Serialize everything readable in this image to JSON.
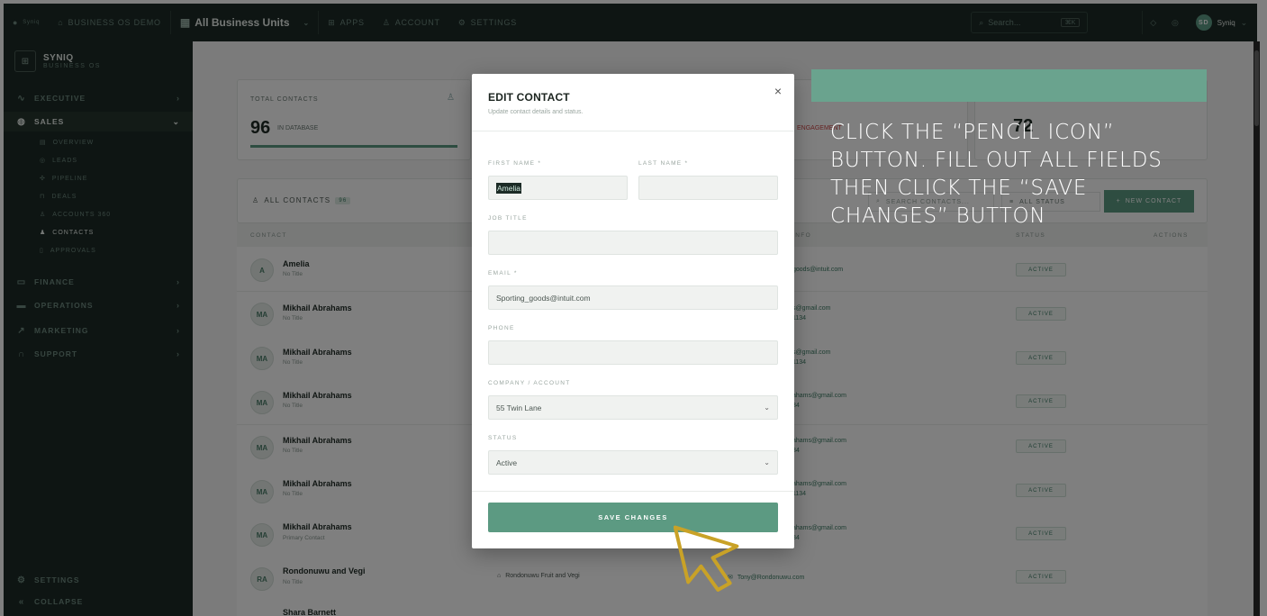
{
  "topbar": {
    "brand_small": "Syniq",
    "demo": "BUSINESS OS DEMO",
    "units": "All Business Units",
    "nav": [
      "APPS",
      "ACCOUNT",
      "SETTINGS"
    ],
    "search_placeholder": "Search...",
    "search_kbd": "⌘K",
    "user_initials": "SD",
    "user_name": "Syniq"
  },
  "sidebar": {
    "brand_name": "SYNIQ",
    "brand_sub": "BUSINESS OS",
    "sections": [
      {
        "label": "EXECUTIVE",
        "icon": "pulse-icon"
      },
      {
        "label": "SALES",
        "icon": "globe-icon"
      },
      {
        "label": "FINANCE",
        "icon": "card-icon"
      },
      {
        "label": "OPERATIONS",
        "icon": "folder-icon"
      },
      {
        "label": "MARKETING",
        "icon": "trend-icon"
      },
      {
        "label": "SUPPORT",
        "icon": "headset-icon"
      }
    ],
    "sales_items": [
      "OVERVIEW",
      "LEADS",
      "PIPELINE",
      "DEALS",
      "ACCOUNTS 360",
      "CONTACTS",
      "APPROVALS"
    ],
    "settings": "SETTINGS",
    "collapse": "COLLAPSE"
  },
  "stats": {
    "total_label": "TOTAL CONTACTS",
    "total_value": "96",
    "total_sub": "IN DATABASE",
    "engagement_label": "ENGAGEMENT",
    "active_value": "72"
  },
  "contacts": {
    "header": "ALL CONTACTS",
    "count": "96",
    "search_placeholder": "SEARCH CONTACTS...",
    "status_filter": "ALL STATUS",
    "new_button": "NEW CONTACT",
    "columns": [
      "CONTACT",
      "INFO",
      "STATUS",
      "ACTIONS"
    ],
    "rows": [
      {
        "initials": "A",
        "name": "Amelia",
        "sub": "No Title",
        "email": "goods@intuit.com",
        "phone": "",
        "status": "ACTIVE"
      },
      {
        "initials": "MA",
        "name": "Mikhail Abrahams",
        "sub": "No Title",
        "email": "s@gmail.com",
        "phone": "1134",
        "status": "ACTIVE"
      },
      {
        "initials": "MA",
        "name": "Mikhail Abrahams",
        "sub": "No Title",
        "email": "s@gmail.com",
        "phone": "1134",
        "status": "ACTIVE"
      },
      {
        "initials": "MA",
        "name": "Mikhail Abrahams",
        "sub": "No Title",
        "email": "ahams@gmail.com",
        "phone": "34",
        "status": "ACTIVE"
      },
      {
        "initials": "MA",
        "name": "Mikhail Abrahams",
        "sub": "No Title",
        "email": "ahams@gmail.com",
        "phone": "34",
        "status": "ACTIVE"
      },
      {
        "initials": "MA",
        "name": "Mikhail Abrahams",
        "sub": "No Title",
        "email": "ahams@gmail.com",
        "phone": "1134",
        "status": "ACTIVE"
      },
      {
        "initials": "MA",
        "name": "Mikhail Abrahams",
        "sub": "Primary Contact",
        "email": "ahams@gmail.com",
        "phone": "34",
        "status": "ACTIVE"
      },
      {
        "initials": "RA",
        "name": "Rondonuwu and Vegi",
        "sub": "No Title",
        "email": "Tony@Rondonuwu.com",
        "phone": "",
        "status": "ACTIVE",
        "company": "Rondonuwu Fruit and Vegi"
      },
      {
        "initials": "",
        "name": "Shara Barnett",
        "sub": "",
        "email": "",
        "phone": "",
        "status": ""
      }
    ]
  },
  "modal": {
    "title": "EDIT CONTACT",
    "subtitle": "Update contact details and status.",
    "close": "×",
    "first_name_label": "FIRST NAME *",
    "first_name_value": "Amelia",
    "last_name_label": "LAST NAME *",
    "last_name_value": "",
    "job_title_label": "JOB TITLE",
    "job_title_value": "",
    "email_label": "EMAIL *",
    "email_value": "Sporting_goods@intuit.com",
    "phone_label": "PHONE",
    "phone_value": "",
    "company_label": "COMPANY / ACCOUNT",
    "company_value": "55 Twin Lane",
    "status_label": "STATUS",
    "status_value": "Active",
    "save_label": "SAVE CHANGES"
  },
  "instruction": {
    "text": "CLICK THE “PENCIL ICON” BUTTON. FILL OUT ALL FIELDS THEN CLICK THE “SAVE CHANGES” BUTTON"
  },
  "colors": {
    "accent": "#5c9a82",
    "dark": "#1c2b26",
    "cursor": "#c9a227"
  }
}
